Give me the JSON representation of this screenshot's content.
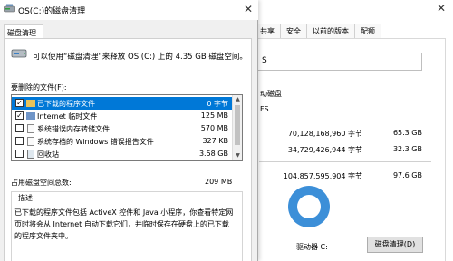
{
  "background_window": {
    "tabs": [
      "共享",
      "安全",
      "以前的版本",
      "配额"
    ],
    "name_field": "S",
    "type_label": "动磁盘",
    "filesystem": "FS",
    "used_bytes": "70,128,168,960 字节",
    "used_size": "65.3 GB",
    "free_bytes": "34,729,426,944 字节",
    "free_size": "32.3 GB",
    "capacity_bytes": "104,857,595,904 字节",
    "capacity_size": "97.6 GB",
    "drive_label": "驱动器 C:",
    "cleanup_button": "磁盘清理(D)",
    "close_glyph": "✕",
    "donut_color": "#3c8fd8"
  },
  "dialog": {
    "title": "OS(C:)的磁盘清理",
    "close_glyph": "✕",
    "tab": "磁盘清理",
    "intro": "可以使用“磁盘清理”来释放 OS (C:) 上的 4.35 GB 磁盘空间。",
    "files_label": "要删除的文件(F):",
    "files": [
      {
        "checked": true,
        "name": "已下载的程序文件",
        "size": "0 字节",
        "selected": true,
        "icon": "folder-icon"
      },
      {
        "checked": true,
        "name": "Internet 临时文件",
        "size": "125 MB",
        "selected": false,
        "icon": "lock-icon"
      },
      {
        "checked": false,
        "name": "系统错误内存转储文件",
        "size": "570 MB",
        "selected": false,
        "icon": "file-icon"
      },
      {
        "checked": false,
        "name": "系统存档的 Windows 错误报告文件",
        "size": "327 KB",
        "selected": false,
        "icon": "file-icon"
      },
      {
        "checked": false,
        "name": "回收站",
        "size": "3.58 GB",
        "selected": false,
        "icon": "recycle-bin-icon"
      }
    ],
    "check_glyph": "✓",
    "total_label": "占用磁盘空间总数:",
    "total_value": "209 MB",
    "description_title": "描述",
    "description_lines": [
      "已下载的程序文件包括 ActiveX 控件和 Java 小程序，你查看特定网",
      "页时将会从 Internet 自动下载它们，并临时保存在硬盘上的已下载",
      "的程序文件夹中。"
    ],
    "accent_color": "#0078d7"
  }
}
